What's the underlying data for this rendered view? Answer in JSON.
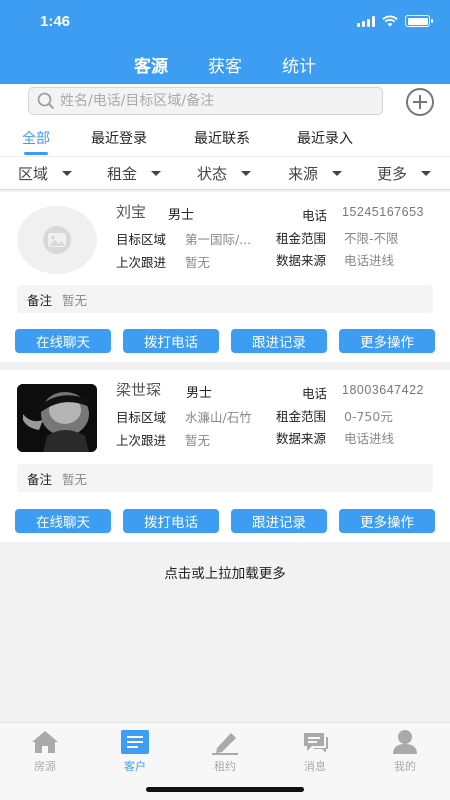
{
  "status": {
    "time": "1:46"
  },
  "tabs": [
    {
      "label": "客源",
      "active": true
    },
    {
      "label": "获客",
      "active": false
    },
    {
      "label": "统计",
      "active": false
    }
  ],
  "search": {
    "placeholder": "姓名/电话/目标区域/备注"
  },
  "filter_tabs": [
    {
      "label": "全部",
      "active": true
    },
    {
      "label": "最近登录",
      "active": false
    },
    {
      "label": "最近联系",
      "active": false
    },
    {
      "label": "最近录入",
      "active": false
    }
  ],
  "dropdowns": [
    {
      "label": "区域"
    },
    {
      "label": "租金"
    },
    {
      "label": "状态"
    },
    {
      "label": "来源"
    },
    {
      "label": "更多"
    }
  ],
  "labels": {
    "target_area": "目标区域",
    "last_follow": "上次跟进",
    "phone": "电话",
    "rent_range": "租金范围",
    "data_source": "数据来源",
    "remark": "备注"
  },
  "customers": [
    {
      "name": "刘宝",
      "gender": "男士",
      "phone": "15245167653",
      "target_area": "第一国际/...",
      "rent_range": "不限-不限",
      "last_follow": "暂无",
      "data_source": "电话进线",
      "remark": "暂无",
      "avatar": "placeholder-image-icon"
    },
    {
      "name": "梁世琛",
      "gender": "男士",
      "phone": "18003647422",
      "target_area": "水濂山/石竹",
      "rent_range": "0-750元",
      "last_follow": "暂无",
      "data_source": "电话进线",
      "remark": "暂无",
      "avatar": "photo"
    }
  ],
  "actions": [
    "在线聊天",
    "拨打电话",
    "跟进记录",
    "更多操作"
  ],
  "load_more": "点击或上拉加载更多",
  "bottom_nav": [
    {
      "label": "房源",
      "icon": "house-icon",
      "active": false
    },
    {
      "label": "客户",
      "icon": "list-icon",
      "active": true
    },
    {
      "label": "租约",
      "icon": "pen-icon",
      "active": false
    },
    {
      "label": "消息",
      "icon": "chat-icon",
      "active": false
    },
    {
      "label": "我的",
      "icon": "user-icon",
      "active": false
    }
  ],
  "colors": {
    "primary": "#3d9df2",
    "inactive": "#aaaaaa"
  }
}
